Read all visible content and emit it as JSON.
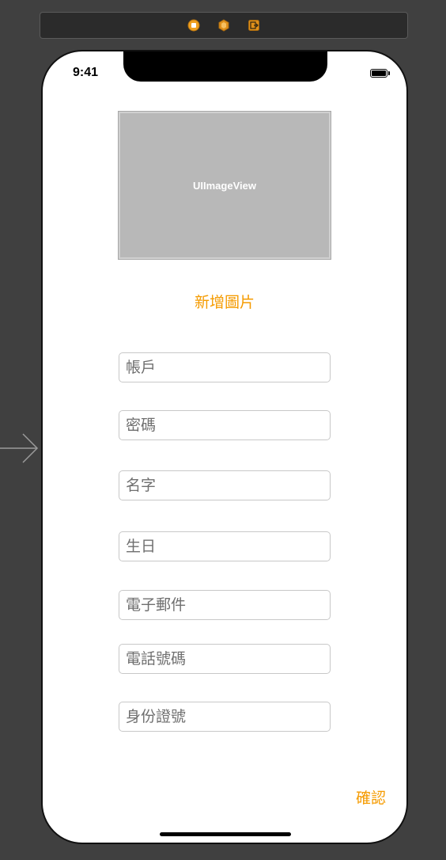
{
  "scene_dock": {
    "icons": [
      "view-controller-icon",
      "first-responder-icon",
      "exit-icon"
    ]
  },
  "status_bar": {
    "time": "9:41"
  },
  "image_view": {
    "label": "UIImageView"
  },
  "add_image_button": {
    "label": "新增圖片"
  },
  "fields": {
    "account": {
      "placeholder": "帳戶",
      "value": ""
    },
    "password": {
      "placeholder": "密碼",
      "value": ""
    },
    "name": {
      "placeholder": "名字",
      "value": ""
    },
    "birthday": {
      "placeholder": "生日",
      "value": ""
    },
    "email": {
      "placeholder": "電子郵件",
      "value": ""
    },
    "phone": {
      "placeholder": "電話號碼",
      "value": ""
    },
    "id_number": {
      "placeholder": "身份證號",
      "value": ""
    }
  },
  "confirm_button": {
    "label": "確認"
  },
  "colors": {
    "accent": "#f59b00",
    "canvas_background": "#404040",
    "image_placeholder": "#b8b8b8"
  }
}
